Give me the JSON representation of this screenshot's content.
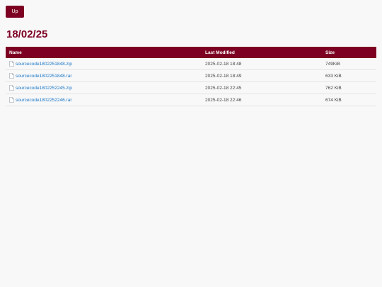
{
  "nav": {
    "up_label": "Up"
  },
  "page_title": "18/02/25",
  "table": {
    "headers": {
      "name": "Name",
      "modified": "Last Modified",
      "size": "Size"
    },
    "rows": [
      {
        "name": "sourcecode1802251848.zip",
        "modified": "2025-02-18 18:48",
        "size": "749KiB"
      },
      {
        "name": "sourcecode1802251848.rar",
        "modified": "2025-02-18 18:49",
        "size": "633 KiB"
      },
      {
        "name": "sourcecode1802252245.zip",
        "modified": "2025-02-18 22:45",
        "size": "762 KiB"
      },
      {
        "name": "sourcecode1802252246.rar",
        "modified": "2025-02-18 22:46",
        "size": "674 KiB"
      }
    ]
  },
  "colors": {
    "accent": "#7d0022",
    "link": "#1976c6",
    "background": "#f8f8f8"
  },
  "icons": {
    "file": "file-icon"
  }
}
